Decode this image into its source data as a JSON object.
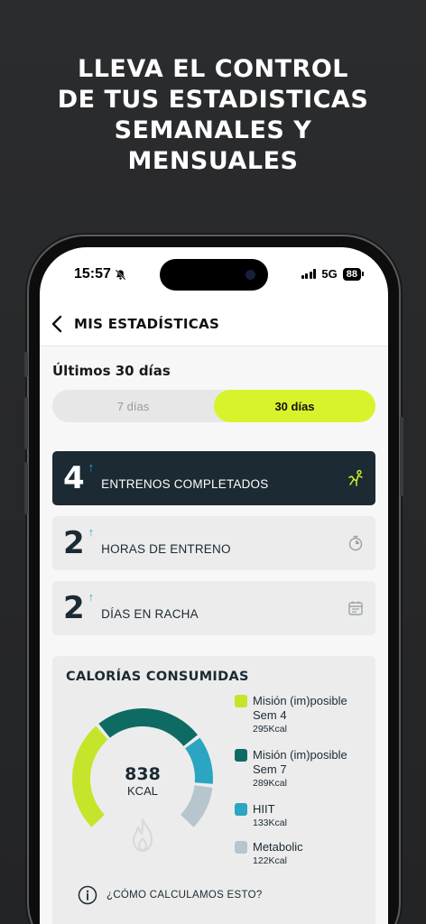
{
  "headline": {
    "lines": [
      "LLEVA EL CONTROL",
      "DE TUS ESTADISTICAS",
      "SEMANALES Y",
      "MENSUALES"
    ]
  },
  "status_bar": {
    "time": "15:57",
    "network": "5G",
    "battery": "88"
  },
  "navbar": {
    "title": "MIS ESTADÍSTICAS"
  },
  "period": {
    "title": "Últimos 30 días",
    "options": [
      "7 días",
      "30 días"
    ],
    "selected": "30 días"
  },
  "stats": [
    {
      "value": "4",
      "label": "ENTRENOS COMPLETADOS",
      "icon": "workout-person-icon"
    },
    {
      "value": "2",
      "label": "HORAS DE ENTRENO",
      "icon": "stopwatch-icon"
    },
    {
      "value": "2",
      "label": "DÍAS EN RACHA",
      "icon": "calendar-icon"
    }
  ],
  "calories": {
    "title": "CALORÍAS CONSUMIDAS",
    "total": "838",
    "unit": "KCAL",
    "info_text": "¿CÓMO CALCULAMOS ESTO?",
    "colors": {
      "lime": "#c5e52a",
      "teal_dark": "#0e6b63",
      "cyan": "#2aa5c2",
      "grey": "#b7c5cc"
    }
  },
  "chart_data": {
    "type": "pie",
    "title": "CALORÍAS CONSUMIDAS",
    "categories": [
      "Misión (im)posible Sem 4",
      "Misión (im)posible Sem 7",
      "HIIT",
      "Metabolic"
    ],
    "values": [
      295,
      289,
      133,
      122
    ],
    "value_labels": [
      "295Kcal",
      "289Kcal",
      "133Kcal",
      "122Kcal"
    ],
    "colors": [
      "#c5e52a",
      "#0e6b63",
      "#2aa5c2",
      "#b7c5cc"
    ],
    "legend": "right",
    "center_label": "838 KCAL"
  },
  "colors": {
    "accent": "#d8f32b",
    "dark_card": "#1b2a33",
    "arrow_blue": "#3da0e0"
  }
}
